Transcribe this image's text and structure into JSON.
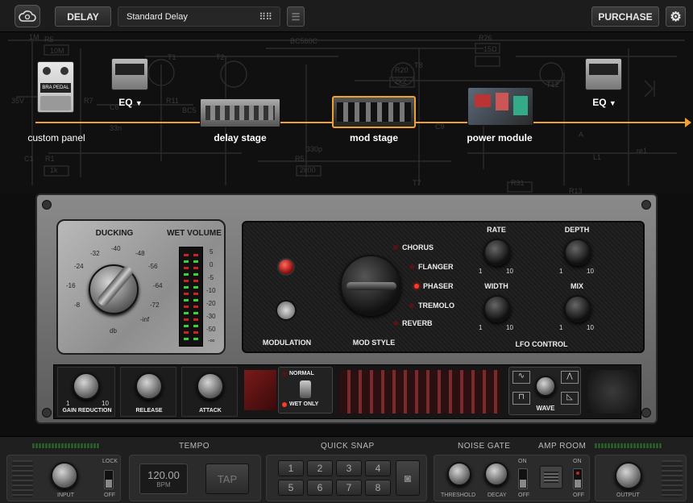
{
  "toolbar": {
    "mode_label": "DELAY",
    "preset_name": "Standard Delay",
    "purchase_label": "PURCHASE"
  },
  "chain": {
    "custom_panel_label": "custom panel",
    "eq_left_label": "EQ",
    "delay_stage_label": "delay stage",
    "mod_stage_label": "mod stage",
    "power_module_label": "power module",
    "eq_right_label": "EQ",
    "pedal_text": "BRA PEDAL",
    "schematic_labels": [
      "1M",
      "R5",
      "10M",
      "T1",
      "T2",
      "BC560C",
      "R26",
      "15Ω",
      "R20",
      "T8",
      "T12",
      "2k2",
      "35V",
      "R7",
      "R11",
      "C6",
      "33n",
      "BC5",
      "C1",
      "R1",
      "1k",
      "R5",
      "330p",
      "2k00",
      "C9",
      "T7",
      "R31",
      "A",
      "L1",
      "re1",
      "R13",
      "LS1",
      "BD139",
      "IRF540",
      "IRF9540"
    ]
  },
  "rack": {
    "ducking_title": "DUCKING",
    "wet_volume_title": "WET VOLUME",
    "ducking_scale": [
      "-40",
      "-32",
      "-24",
      "-16",
      "-8",
      "-48",
      "-56",
      "-64",
      "-72",
      "-inf"
    ],
    "ducking_unit": "db",
    "meter_scale": [
      "5",
      "0",
      "-5",
      "-10",
      "-20",
      "-30",
      "-50",
      "-∞"
    ],
    "modulation_label": "MODULATION",
    "mod_style_label": "MOD STYLE",
    "mod_styles": [
      "CHORUS",
      "FLANGER",
      "PHASER",
      "TREMOLO",
      "REVERB"
    ],
    "selected_style": "PHASER",
    "lfo_knobs": [
      {
        "label": "RATE",
        "min": "1",
        "max": "10"
      },
      {
        "label": "DEPTH",
        "min": "1",
        "max": "10"
      },
      {
        "label": "WIDTH",
        "min": "1",
        "max": "10"
      },
      {
        "label": "MIX",
        "min": "1",
        "max": "10"
      }
    ],
    "lfo_control_label": "LFO CONTROL",
    "lower": {
      "gain_reduction_label": "GAIN REDUCTION",
      "gain_min": "1",
      "gain_max": "10",
      "release_label": "RELEASE",
      "attack_label": "ATTACK",
      "normal_label": "NORMAL",
      "wet_only_label": "WET ONLY",
      "wave_label": "WAVE"
    }
  },
  "bottom": {
    "input_label": "INPUT",
    "lock_label": "LOCK",
    "off_label": "OFF",
    "tempo_title": "TEMPO",
    "tempo_value": "120.00",
    "tempo_unit": "BPM",
    "tap_label": "TAP",
    "quick_snap_title": "QUICK SNAP",
    "snaps": [
      "1",
      "2",
      "3",
      "4",
      "5",
      "6",
      "7",
      "8"
    ],
    "noise_gate_title": "NOISE GATE",
    "threshold_label": "THRESHOLD",
    "decay_label": "DECAY",
    "on_label": "ON",
    "amp_room_title": "AMP ROOM",
    "output_label": "OUTPUT"
  },
  "colors": {
    "accent": "#f0a030",
    "led_red": "#d22222",
    "meter_green": "#3ad13a"
  }
}
